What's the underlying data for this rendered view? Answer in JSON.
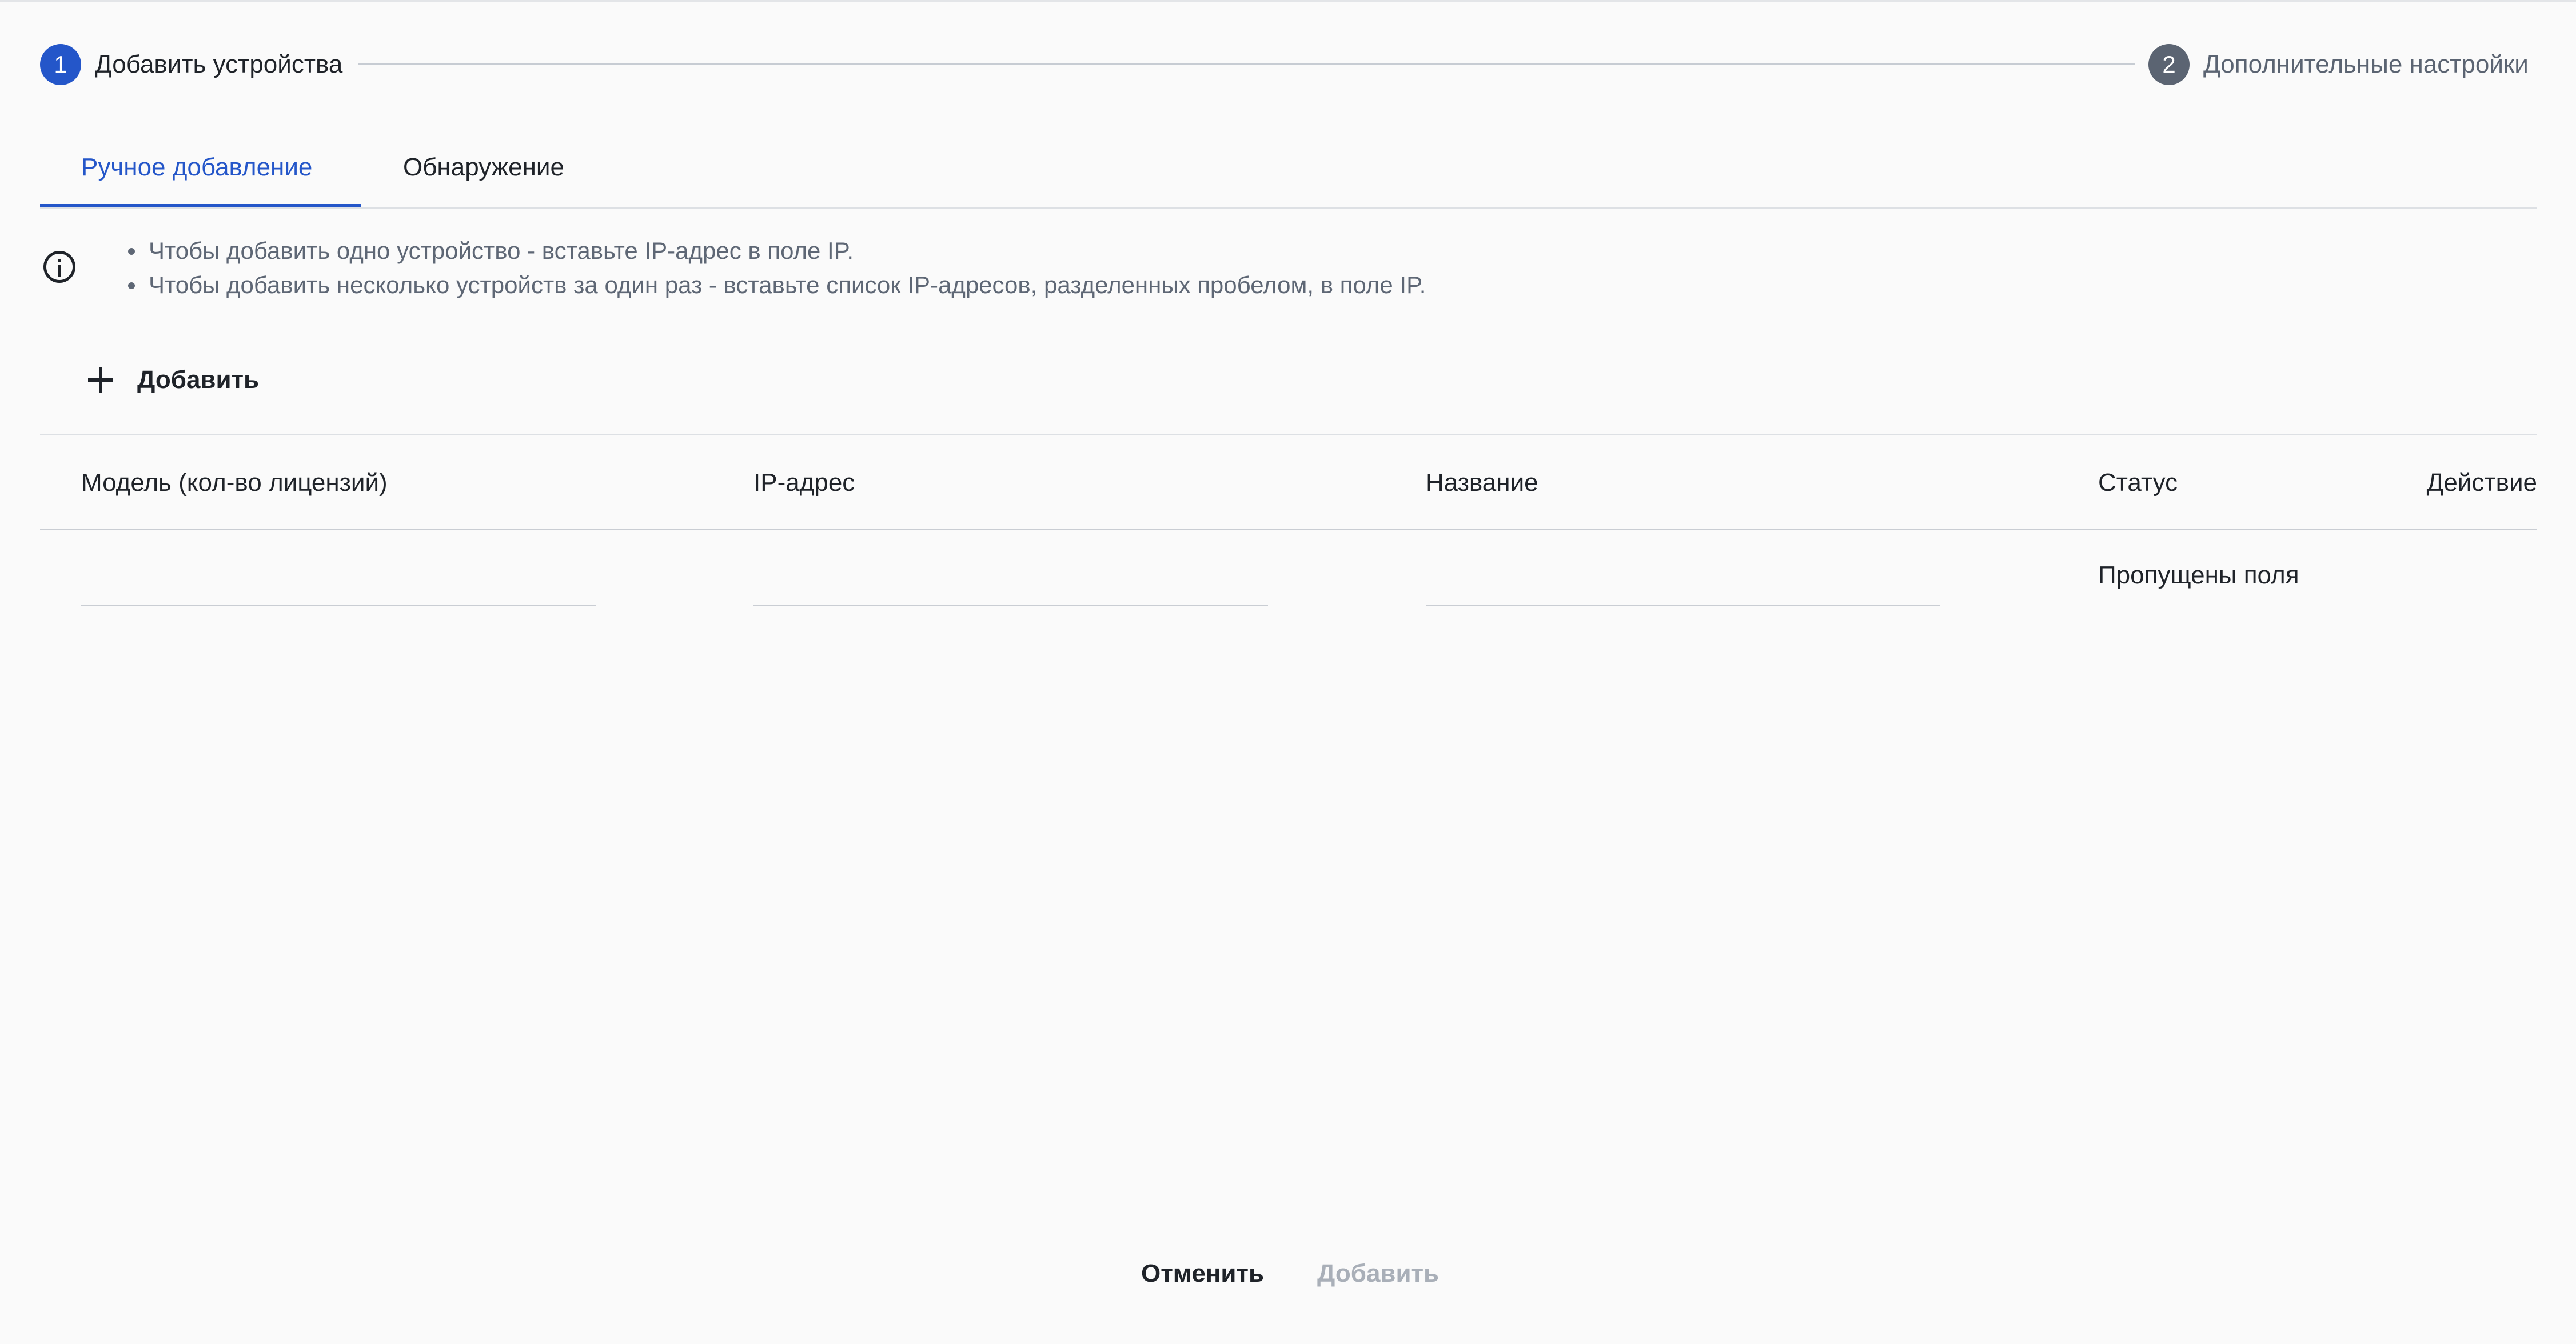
{
  "stepper": {
    "steps": [
      {
        "number": "1",
        "label": "Добавить устройства",
        "state": "active",
        "color": "#2456c9"
      },
      {
        "number": "2",
        "label": "Дополнительные настройки",
        "state": "inactive",
        "color": "#5b6472"
      }
    ]
  },
  "tabs": [
    {
      "label": "Ручное добавление",
      "active": true,
      "color": "#2456c9"
    },
    {
      "label": "Обнаружение",
      "active": false
    }
  ],
  "info": {
    "icon": "info-icon",
    "hints": [
      "Чтобы добавить одно устройство - вставьте IP-адрес в поле IP.",
      "Чтобы добавить несколько устройств за один раз - вставьте список IP-адресов, разделенных пробелом, в поле IP."
    ]
  },
  "add_row": {
    "icon": "plus-icon",
    "label": "Добавить"
  },
  "table": {
    "columns": [
      "Модель (кол-во лицензий)",
      "IP-адрес",
      "Название",
      "Статус",
      "Действие"
    ],
    "rows": [
      {
        "model": "",
        "ip": "",
        "name": "",
        "status": "Пропущены поля",
        "action": ""
      }
    ]
  },
  "footer": {
    "cancel_label": "Отменить",
    "submit_label": "Добавить",
    "submit_disabled": true,
    "disabled_color": "#a9afb8"
  }
}
